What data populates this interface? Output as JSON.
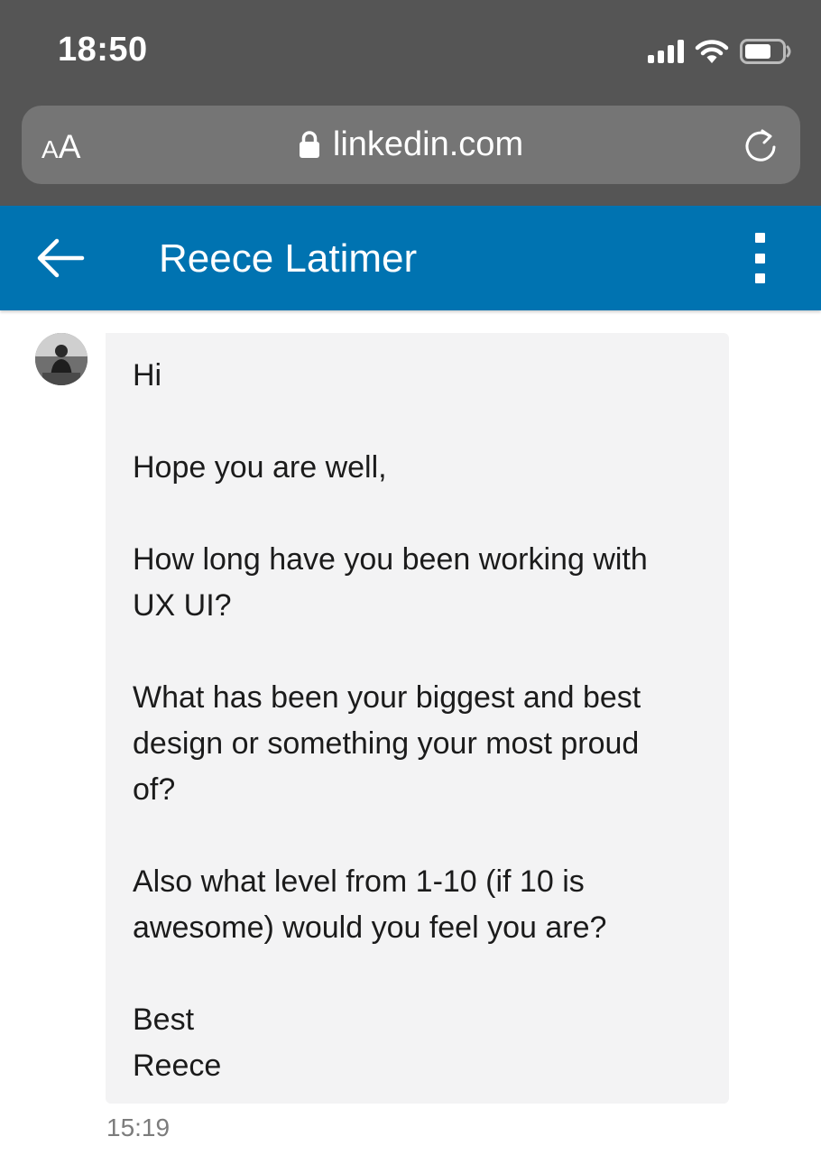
{
  "status_bar": {
    "time": "18:50",
    "icons": [
      "cellular-signal-icon",
      "wifi-icon",
      "battery-icon"
    ]
  },
  "browser": {
    "text_size_small": "A",
    "text_size_large": "A",
    "url": "linkedin.com",
    "lock_icon": "lock-icon",
    "reload_icon": "reload-icon"
  },
  "header": {
    "title": "Reece Latimer",
    "back_icon": "arrow-left-icon",
    "menu_icon": "more-vertical-icon",
    "background": "#0073b1"
  },
  "message": {
    "lines": [
      "Hi",
      "",
      "Hope you are well,",
      "",
      "How long have you been working with",
      "UX UI?",
      "",
      "What has been your biggest and best",
      "design or something your most proud",
      "of?",
      "",
      "Also what level from 1-10 (if 10 is",
      "awesome) would you feel you are?",
      "",
      "Best",
      "Reece"
    ],
    "timestamp": "15:19"
  },
  "colors": {
    "chrome": "#555555",
    "url_bar": "#757575",
    "bubble": "#f3f3f4",
    "text": "#1b1b1b",
    "timestamp": "#7c7c7c"
  }
}
